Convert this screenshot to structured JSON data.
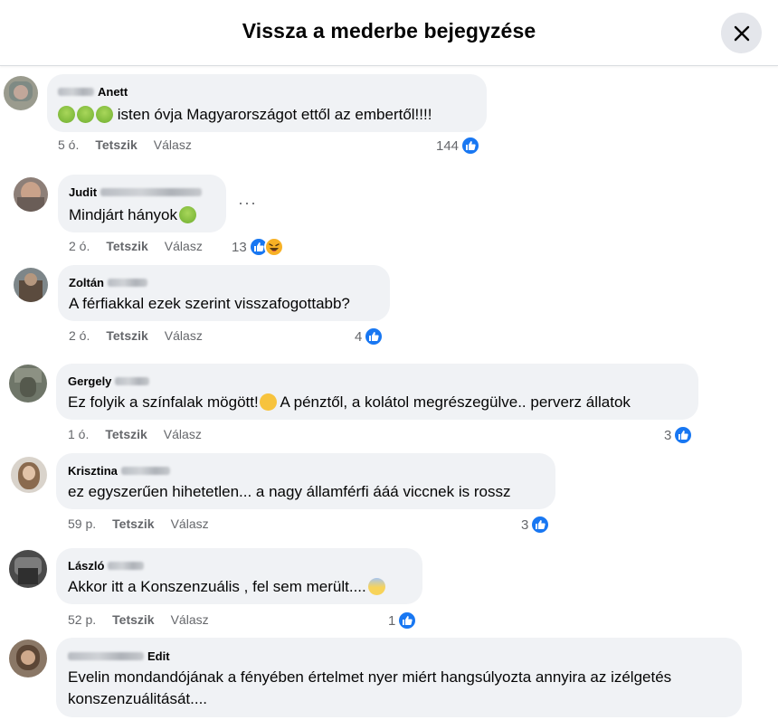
{
  "dialog": {
    "title": "Vissza a mederbe bejegyzése"
  },
  "comments": [
    {
      "name": "Anett",
      "text": "isten óvja Magyarországot ettől az embertől!!!!",
      "time": "5 ó.",
      "like_label": "Tetszik",
      "reply_label": "Válasz",
      "reaction_count": "144",
      "reactions": [
        "like"
      ]
    },
    {
      "name": "Judit",
      "text": "Mindjárt hányok",
      "time": "2 ó.",
      "like_label": "Tetszik",
      "reply_label": "Válasz",
      "reaction_count": "13",
      "reactions": [
        "like",
        "haha"
      ]
    },
    {
      "name": "Zoltán",
      "text": "A férfiakkal ezek szerint visszafogottabb?",
      "time": "2 ó.",
      "like_label": "Tetszik",
      "reply_label": "Válasz",
      "reaction_count": "4",
      "reactions": [
        "like"
      ]
    },
    {
      "name": "Gergely",
      "text_part1": "Ez folyik a színfalak mögött!",
      "text_part2": " A pénztől, a kolátol megrészegülve.. perverz állatok",
      "time": "1 ó.",
      "like_label": "Tetszik",
      "reply_label": "Válasz",
      "reaction_count": "3",
      "reactions": [
        "like"
      ]
    },
    {
      "name": "Krisztina",
      "text": "ez egyszerűen hihetetlen... a nagy államférfi ááá viccnek is rossz",
      "time": "59 p.",
      "like_label": "Tetszik",
      "reply_label": "Válasz",
      "reaction_count": "3",
      "reactions": [
        "like"
      ]
    },
    {
      "name": "László",
      "text": "Akkor itt a Konszenzuális , fel sem merült....",
      "time": "52 p.",
      "like_label": "Tetszik",
      "reply_label": "Válasz",
      "reaction_count": "1",
      "reactions": [
        "like"
      ]
    },
    {
      "name": "Edit",
      "text_line1": "Evelin mondandójának a fényében értelmet nyer miért hangsúlyozta annyira az izélgetés",
      "text_line2": "konszenzuálitását...."
    }
  ],
  "icons": {
    "close": "close-icon",
    "like": "thumbs-up-icon",
    "haha": "laughing-face-icon",
    "more": "more-options-icon"
  },
  "colors": {
    "accent": "#1877f2",
    "bubble": "#f0f2f5",
    "secondary_text": "#65676b",
    "nauseated_emoji": "#7fba3b"
  }
}
